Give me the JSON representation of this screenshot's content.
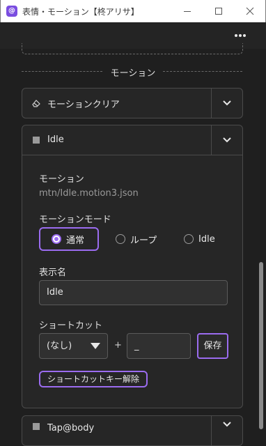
{
  "window": {
    "app_icon_text": "@",
    "title": "表情・モーション【柊アリサ】"
  },
  "section": {
    "label": "モーション"
  },
  "clear_card": {
    "title": "モーションクリア"
  },
  "idle_card": {
    "title": "Idle",
    "motion_label": "モーション",
    "motion_path": "mtn/Idle.motion3.json",
    "mode_label": "モーションモード",
    "modes": [
      "通常",
      "ループ",
      "Idle"
    ],
    "selected_mode": "通常",
    "display_name_label": "表示名",
    "display_name_value": "Idle",
    "shortcut_label": "ショートカット",
    "modifier_value": "(なし)",
    "plus": "+",
    "key_value": "_",
    "save_label": "保存",
    "clear_shortcut_label": "ショートカットキー解除"
  },
  "next_card": {
    "title": "Tap@body"
  },
  "colors": {
    "accent": "#9b6cf0",
    "background": "#1f1f1f",
    "card": "#262626"
  }
}
